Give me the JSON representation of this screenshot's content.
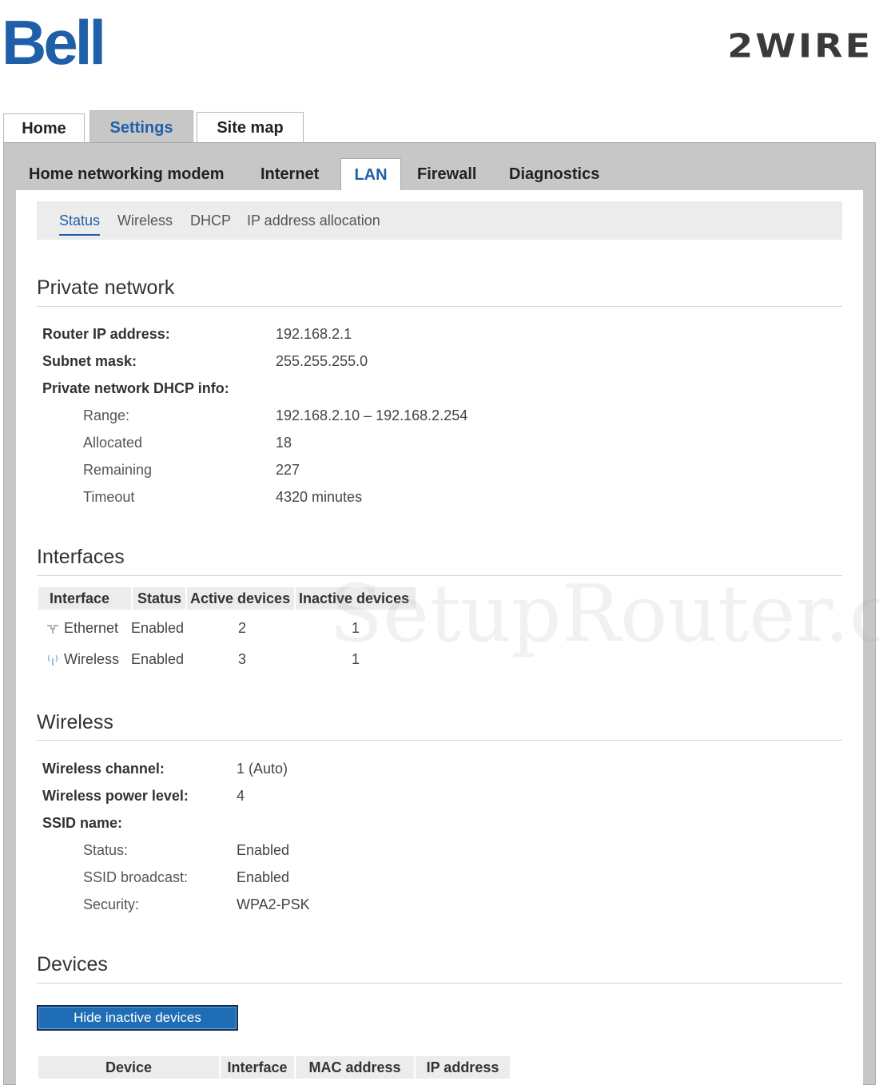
{
  "logos": {
    "left": "Bell",
    "right": "2WIRE"
  },
  "top_tabs": [
    "Home",
    "Settings",
    "Site map"
  ],
  "sub_tabs": [
    "Home networking modem",
    "Internet",
    "LAN",
    "Firewall",
    "Diagnostics"
  ],
  "lan_nav": [
    "Status",
    "Wireless",
    "DHCP",
    "IP address allocation"
  ],
  "private_network": {
    "title": "Private network",
    "router_ip_label": "Router IP address:",
    "router_ip": "192.168.2.1",
    "subnet_label": "Subnet mask:",
    "subnet": "255.255.255.0",
    "dhcp_label": "Private network DHCP info:",
    "range_label": "Range:",
    "range": "192.168.2.10 – 192.168.2.254",
    "allocated_label": "Allocated",
    "allocated": "18",
    "remaining_label": "Remaining",
    "remaining": "227",
    "timeout_label": "Timeout",
    "timeout": "4320 minutes"
  },
  "interfaces": {
    "title": "Interfaces",
    "headers": [
      "Interface",
      "Status",
      "Active devices",
      "Inactive devices"
    ],
    "rows": [
      {
        "name": "Ethernet",
        "status": "Enabled",
        "active": "2",
        "inactive": "1",
        "icon": "ethernet-icon"
      },
      {
        "name": "Wireless",
        "status": "Enabled",
        "active": "3",
        "inactive": "1",
        "icon": "wireless-icon"
      }
    ]
  },
  "wireless": {
    "title": "Wireless",
    "channel_label": "Wireless channel:",
    "channel": "1 (Auto)",
    "power_label": "Wireless power level:",
    "power": "4",
    "ssid_label": "SSID name:",
    "status_label": "Status:",
    "status": "Enabled",
    "broadcast_label": "SSID broadcast:",
    "broadcast": "Enabled",
    "security_label": "Security:",
    "security": "WPA2-PSK"
  },
  "devices": {
    "title": "Devices",
    "hide_button": "Hide inactive devices",
    "headers": [
      "Device",
      "Interface",
      "MAC address",
      "IP address"
    ]
  },
  "watermark": "SetupRouter.co",
  "colors": {
    "accent": "#1f5fa8",
    "frame": "#c7c7c7",
    "button": "#1f6db5"
  }
}
